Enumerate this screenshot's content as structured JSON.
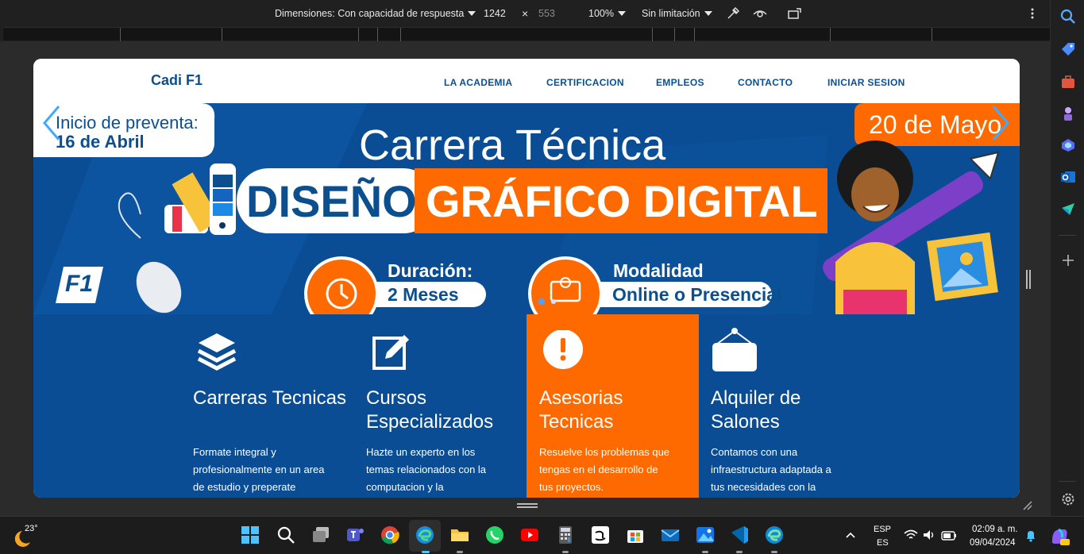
{
  "devtools": {
    "dimensions_label": "Dimensiones: Con capacidad de respuesta",
    "width": "1242",
    "times": "×",
    "height": "553",
    "zoom": "100%",
    "throttle": "Sin limitación"
  },
  "site": {
    "brand": "Cadi F1",
    "nav": [
      "LA ACADEMIA",
      "CERTIFICACION",
      "EMPLEOS",
      "CONTACTO",
      "INICIAR SESION"
    ]
  },
  "banner": {
    "presale_line1": "Inicio de preventa:",
    "presale_line2": "16 de Abril",
    "date": "20 de Mayo",
    "headline": "Carrera Técnica",
    "word1": "DISEÑO",
    "word2": "GRÁFICO DIGITAL",
    "logo": "F1",
    "duration_label": "Duración:",
    "duration_value": "2 Meses",
    "mode_label": "Modalidad",
    "mode_value": "Online o Presencial"
  },
  "services": [
    {
      "title": "Carreras Tecnicas",
      "desc": "Formate integral y profesionalmente en un area de estudio y preperate",
      "icon": "layers-icon"
    },
    {
      "title": "Cursos Especializados",
      "desc": "Hazte un experto en los temas relacionados con la computacion y la",
      "icon": "edit-icon"
    },
    {
      "title": "Asesorias Tecnicas",
      "desc": "Resuelve los problemas que tengas en el desarrollo de tus proyectos.",
      "icon": "alert-icon"
    },
    {
      "title": "Alquiler de Salones",
      "desc": "Contamos con una infraestructura adaptada a tus necesidades con la",
      "icon": "sign-icon"
    }
  ],
  "taskbar": {
    "weather": "23°",
    "lang1": "ESP",
    "lang2": "ES",
    "time": "02:09 a. m.",
    "date": "09/04/2024"
  },
  "colors": {
    "brand_blue": "#0b4f8f",
    "banner_blue": "#0a4d94",
    "orange": "#ff6a00"
  }
}
